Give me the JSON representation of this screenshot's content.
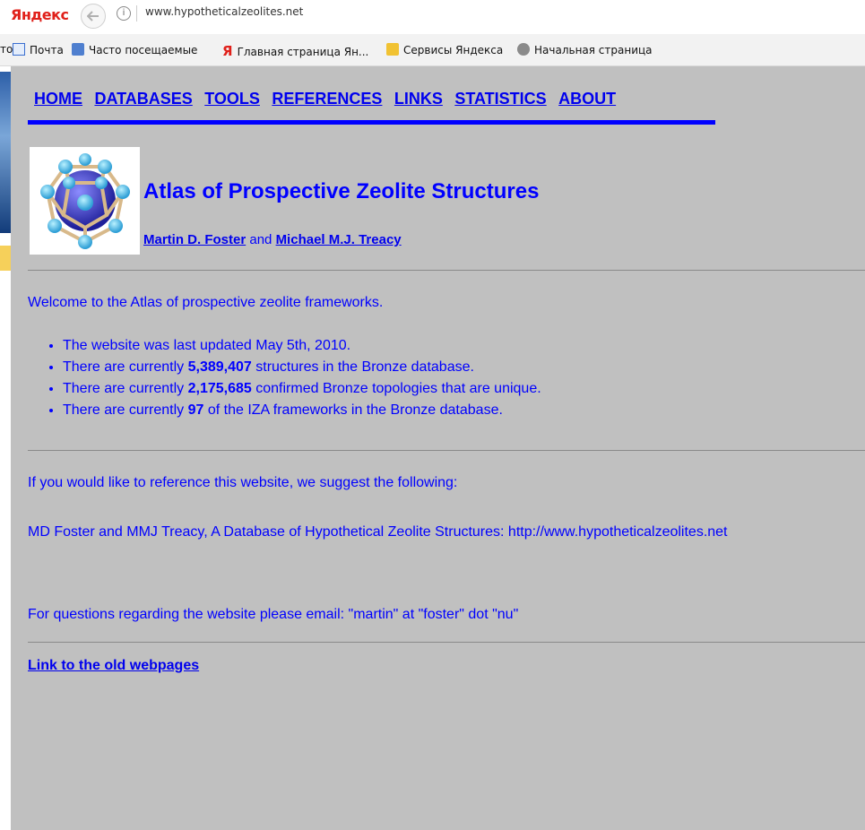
{
  "browser": {
    "brand": "Яндекс",
    "url": "www.hypotheticalzeolites.net",
    "info_glyph": "i",
    "bookmarks": [
      {
        "label": "Почта",
        "icon": "mail-icon"
      },
      {
        "label": "Часто посещаемые",
        "icon": "frequent-icon"
      },
      {
        "label": "Главная страница Ян...",
        "icon": "yandex-icon"
      },
      {
        "label": "Сервисы Яндекса",
        "icon": "folder-icon"
      },
      {
        "label": "Начальная страница",
        "icon": "globe-icon"
      }
    ],
    "bookmark_cut_text": "то"
  },
  "nav": {
    "items": [
      "HOME",
      "DATABASES",
      "TOOLS",
      "REFERENCES",
      "LINKS",
      "STATISTICS",
      "ABOUT"
    ]
  },
  "header": {
    "title": "Atlas of Prospective Zeolite Structures",
    "author1": "Martin D. Foster",
    "and": "and",
    "author2": "Michael M.J. Treacy"
  },
  "welcome": "Welcome to the Atlas of prospective zeolite frameworks.",
  "bullets": [
    {
      "before": "The website was last updated May 5th, 2010.",
      "bold": "",
      "after": ""
    },
    {
      "before": "There are currently ",
      "bold": "5,389,407",
      "after": " structures in the Bronze database."
    },
    {
      "before": "There are currently ",
      "bold": "2,175,685",
      "after": " confirmed Bronze topologies that are unique."
    },
    {
      "before": "There are currently ",
      "bold": "97",
      "after": " of the IZA frameworks in the Bronze database."
    }
  ],
  "reference_intro": "If you would like to reference this website, we suggest the following:",
  "reference_citation": "MD Foster and MMJ Treacy, A Database of Hypothetical Zeolite Structures: http://www.hypotheticalzeolites.net",
  "contact": "For questions regarding the website please email: \"martin\" at \"foster\" dot \"nu\"",
  "old_link": "Link to the old webpages",
  "colors": {
    "page_bg": "#c0c0c0",
    "text": "#0000ff",
    "link": "#0000ee",
    "rule": "#0000ff"
  }
}
